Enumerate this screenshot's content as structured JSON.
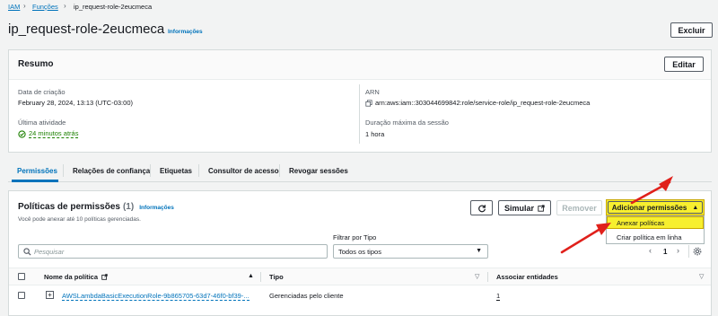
{
  "breadcrumb": {
    "root": "IAM",
    "section": "Funções",
    "current": "ip_request-role-2eucmeca"
  },
  "header": {
    "title": "ip_request-role-2eucmeca",
    "info": "Informações",
    "delete_label": "Excluir"
  },
  "summary": {
    "title": "Resumo",
    "edit_label": "Editar",
    "created_label": "Data de criação",
    "created_value": "February 28, 2024, 13:13 (UTC-03:00)",
    "last_activity_label": "Última atividade",
    "last_activity_value": "24 minutos atrás",
    "arn_label": "ARN",
    "arn_value": "arn:aws:iam::303044699842:role/service-role/ip_request-role-2eucmeca",
    "max_session_label": "Duração máxima da sessão",
    "max_session_value": "1 hora"
  },
  "tabs": [
    "Permissões",
    "Relações de confiança",
    "Etiquetas",
    "Consultor de acesso",
    "Revogar sessões"
  ],
  "policies": {
    "title": "Políticas de permissões",
    "count": "(1)",
    "info": "Informações",
    "subtitle": "Você pode anexar até 10 políticas gerenciadas.",
    "simulate_label": "Simular",
    "remove_label": "Remover",
    "add_label": "Adicionar permissões",
    "dropdown_items": [
      "Anexar políticas",
      "Criar política em linha"
    ],
    "search_placeholder": "Pesquisar",
    "filter_label": "Filtrar por Tipo",
    "filter_value": "Todos os tipos",
    "page": "1",
    "columns": [
      "Nome da política",
      "Tipo",
      "Associar entidades"
    ],
    "rows": [
      {
        "name": "AWSLambdaBasicExecutionRole-9b865705-63d7-46f0-bf39-...",
        "type": "Gerenciadas pelo cliente",
        "entities": "1"
      }
    ]
  },
  "colors": {
    "accent": "#0073bb",
    "highlight": "#f7ef2f",
    "arrow": "#e0201b",
    "success": "#1d8102"
  }
}
